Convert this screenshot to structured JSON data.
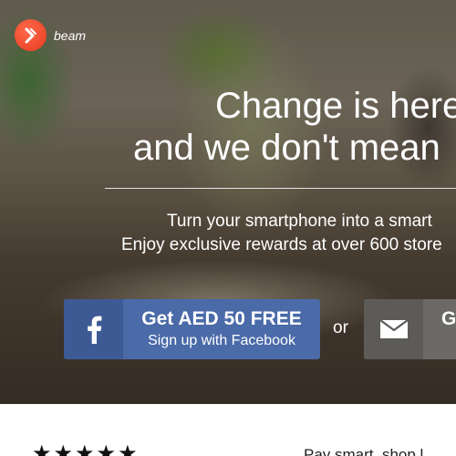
{
  "logo": {
    "wordmark": "beam"
  },
  "hero": {
    "headline_line1": "Change is here",
    "headline_line2": "and we don't mean",
    "subtext_line1": "Turn your smartphone into a smart",
    "subtext_line2": "Enjoy exclusive rewards at over 600 store"
  },
  "cta": {
    "facebook": {
      "main": "Get AED 50 FREE",
      "sub": "Sign up with Facebook",
      "icon": "facebook-icon"
    },
    "separator": "or",
    "email": {
      "main": "G",
      "icon": "envelope-icon"
    }
  },
  "below": {
    "rating_stars": "★★★★★",
    "teaser": "Pay smart, shop l"
  },
  "colors": {
    "facebook_blue": "#4a6aa8",
    "facebook_icon_bg": "#3d5a95",
    "email_gray": "#6c6a67",
    "logo_red": "#e53a1f"
  }
}
